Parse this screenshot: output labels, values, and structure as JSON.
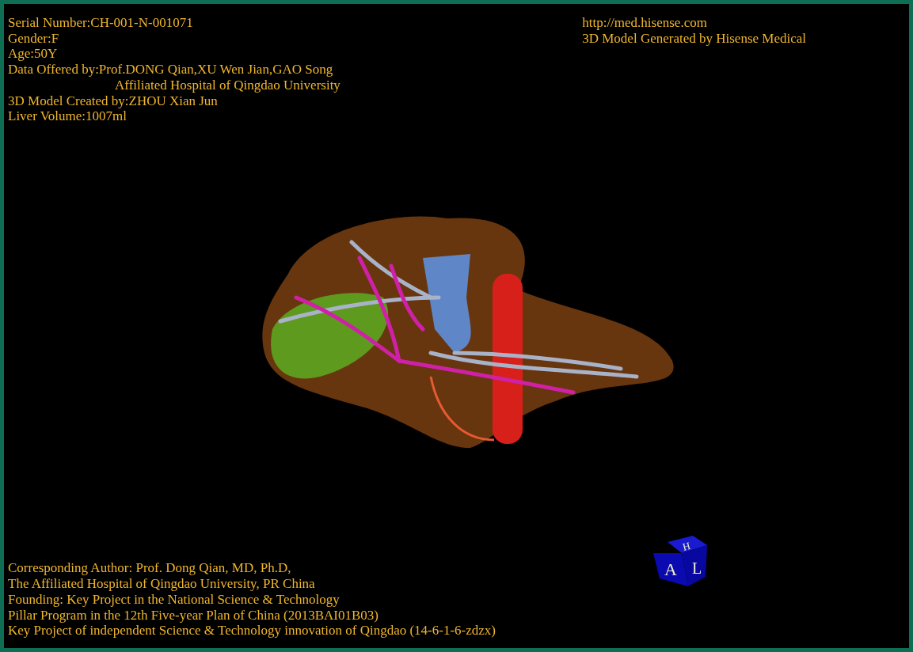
{
  "info_top_left": [
    {
      "kind": "line",
      "text": "Serial Number:CH-001-N-001071"
    },
    {
      "kind": "line",
      "text": "Gender:F"
    },
    {
      "kind": "line",
      "text": "Age:50Y"
    },
    {
      "kind": "line",
      "text": "Data Offered by:Prof.DONG Qian,XU Wen Jian,GAO Song"
    },
    {
      "kind": "continuation",
      "text": "Affiliated Hospital of Qingdao University"
    },
    {
      "kind": "line",
      "text": "3D Model Created by:ZHOU Xian Jun"
    },
    {
      "kind": "line",
      "text": "Liver Volume:1007ml"
    }
  ],
  "info_top_right": [
    "http://med.hisense.com",
    "3D Model Generated by Hisense Medical"
  ],
  "info_bottom": [
    "Corresponding Author: Prof. Dong Qian, MD, Ph.D,",
    "The Affiliated Hospital of Qingdao University, PR China",
    "Founding: Key Project in the National Science & Technology",
    "Pillar Program in the 12th Five-year Plan of China (2013BAI01B03)",
    "Key Project of independent Science & Technology innovation of Qingdao (14-6-1-6-zdzx)"
  ],
  "orientation_cube": {
    "top": "H",
    "front": "A",
    "side": "L"
  }
}
